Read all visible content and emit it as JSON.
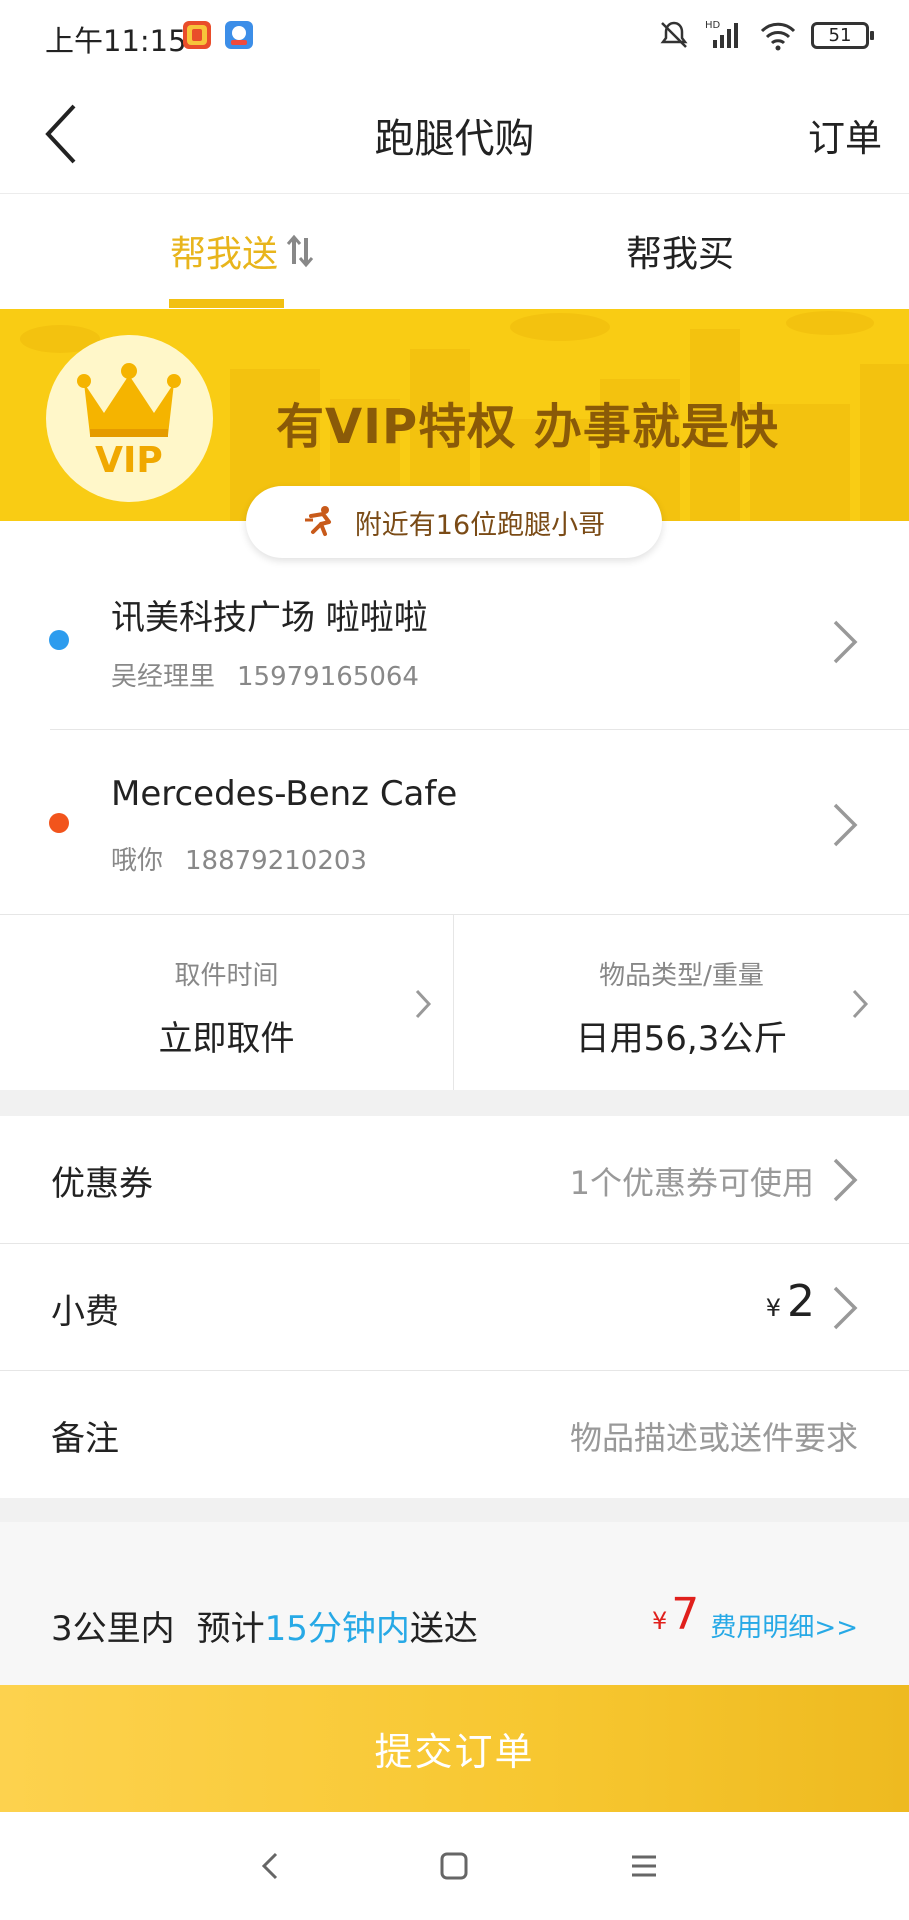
{
  "status_bar": {
    "time": "上午11:15",
    "battery": "51",
    "icons": [
      "app-notification-icon-red",
      "app-notification-icon-blue",
      "mute-icon",
      "hd-signal-icon",
      "wifi-icon",
      "battery-icon"
    ]
  },
  "header": {
    "title": "跑腿代购",
    "right_link": "订单",
    "back_icon": "chevron-left-icon"
  },
  "tabs": {
    "send_label": "帮我送",
    "send_icon": "swap-vertical-icon",
    "buy_label": "帮我买",
    "active": "帮我送"
  },
  "banner": {
    "badge_text": "VIP",
    "slogan": "有VIP特权  办事就是快",
    "nearby_text": "附近有16位跑腿小哥",
    "nearby_icon": "runner-icon"
  },
  "addresses": [
    {
      "name": "讯美科技广场 啦啦啦",
      "contact_name": "吴经理里",
      "phone": "15979165064",
      "dot_color": "#2d9cee"
    },
    {
      "name": "Mercedes-Benz Cafe",
      "contact_name": "哦你",
      "phone": "18879210203",
      "dot_color": "#f2541c"
    }
  ],
  "pickup": {
    "label": "取件时间",
    "value": "立即取件"
  },
  "item": {
    "label": "物品类型/重量",
    "value": "日用56,3公斤"
  },
  "options": {
    "coupon": {
      "label": "优惠券",
      "value": "1个优惠券可使用"
    },
    "tip": {
      "label": "小费",
      "currency": "¥",
      "amount": "2"
    },
    "note": {
      "label": "备注",
      "placeholder": "物品描述或送件要求"
    }
  },
  "summary": {
    "distance": "3公里内",
    "eta_prefix": "预计",
    "eta_highlight": "15分钟内",
    "eta_suffix": "送达",
    "currency": "¥",
    "price": "7",
    "fee_detail": "费用明细>>"
  },
  "submit": {
    "label": "提交订单"
  },
  "colors": {
    "accent": "#f2c012",
    "banner": "#f9cc14",
    "link_blue": "#27a9e6",
    "price_red": "#e0201c"
  }
}
